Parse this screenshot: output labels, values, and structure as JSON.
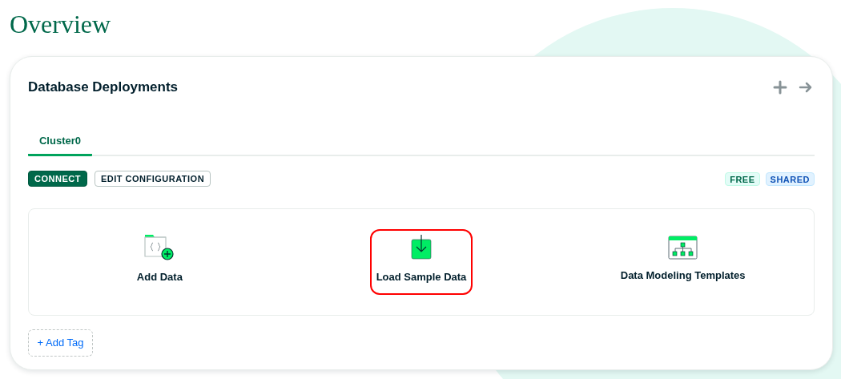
{
  "page": {
    "title": "Overview"
  },
  "card": {
    "title": "Database Deployments",
    "header_icons": [
      {
        "kind": "plus"
      },
      {
        "kind": "arrow"
      }
    ],
    "tabs": [
      {
        "label": "Cluster0",
        "selected": true
      }
    ],
    "buttons": [
      {
        "label": "CONNECT",
        "kind": "primary"
      },
      {
        "label": "EDIT CONFIGURATION",
        "kind": "secondary"
      }
    ],
    "badges": [
      {
        "label": "FREE",
        "color": "#e3fcf7"
      },
      {
        "label": "SHARED",
        "color": "#e1f2ff"
      }
    ],
    "actions": [
      {
        "label": "Add Data",
        "kind": "folder",
        "highlighted": false
      },
      {
        "label": "Load Sample Data",
        "kind": "download",
        "highlighted": true
      },
      {
        "label": "Data Modeling Templates",
        "kind": "tree",
        "highlighted": false
      }
    ],
    "tag_button": "+ Add Tag"
  }
}
